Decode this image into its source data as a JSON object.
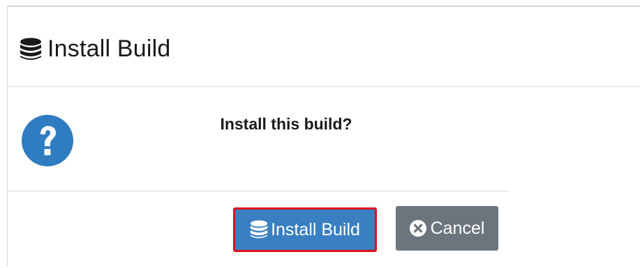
{
  "dialog": {
    "title": "Install Build",
    "title_icon": "database-icon",
    "message": "Install this build?",
    "message_icon": "question-circle-icon"
  },
  "buttons": {
    "install_label": "Install Build",
    "install_icon": "database-icon",
    "cancel_label": "Cancel",
    "cancel_icon": "times-circle-icon"
  },
  "colors": {
    "primary": "#3a7fc1",
    "secondary": "#6c757d",
    "highlight": "#e0101b",
    "question_icon": "#2f7cc1"
  }
}
